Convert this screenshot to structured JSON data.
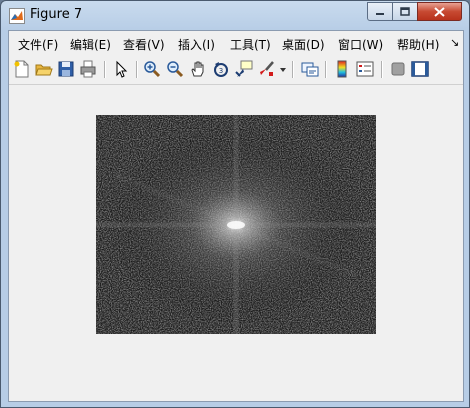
{
  "window": {
    "title": "Figure 7",
    "controls": [
      "minimize-icon",
      "maximize-icon",
      "close-icon"
    ]
  },
  "menu": {
    "items": [
      "文件(F)",
      "编辑(E)",
      "查看(V)",
      "插入(I)",
      "工具(T)",
      "桌面(D)",
      "窗口(W)",
      "帮助(H)"
    ],
    "overflow_icon": "menu-overflow-arrow-icon"
  },
  "toolbar": {
    "icons": [
      "new-figure-icon",
      "open-file-icon",
      "save-icon",
      "print-icon",
      "edit-plot-arrow-icon",
      "zoom-in-icon",
      "zoom-out-icon",
      "pan-hand-icon",
      "rotate-3d-icon",
      "data-cursor-icon",
      "brush-icon",
      "brush-dropdown-icon",
      "link-plot-icon",
      "insert-colorbar-icon",
      "insert-legend-icon",
      "hide-plot-tools-icon",
      "show-plot-tools-icon"
    ]
  },
  "figure": {
    "content": "fft-magnitude-spectrum-image",
    "background": "#f0f0f0"
  }
}
